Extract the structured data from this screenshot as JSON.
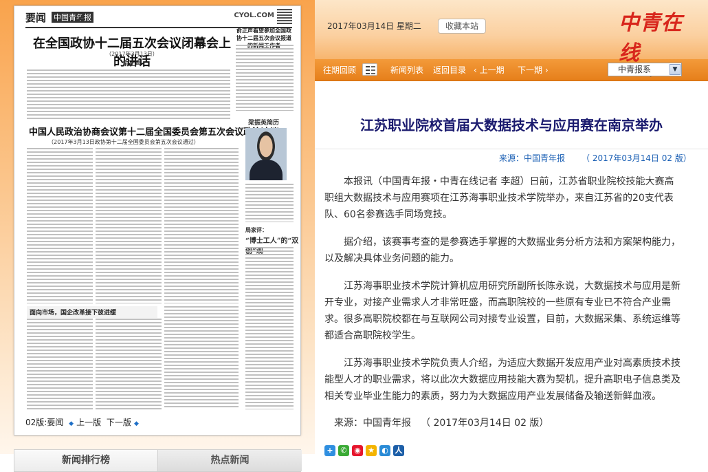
{
  "header": {
    "date": "2017年03月14日  星期二",
    "favorite_label": "收藏本站",
    "logo_text": "中青在线",
    "logo_url": "www.cyol.com"
  },
  "nav": {
    "past_review": "往期回顾",
    "news_list": "新闻列表",
    "back_to_index": "返回目录",
    "prev_edition": "上一期",
    "next_edition": "下一期",
    "paper_select": "中青报系"
  },
  "paper": {
    "section": "要闻",
    "paper_name": "中国青年报",
    "page_number": "2",
    "site": "CYOL.COM",
    "headline1": "在全国政协十二届五次会议闭幕会上的讲话",
    "headline1_date": "（2017年3月13日）",
    "headline1_author": "俞正声",
    "side_title": "俞正声看望参加全国政协十二届五次会议报道的新闻工作者",
    "headline2": "中国人民政治协商会议第十二届全国委员会第五次会议政治决议",
    "headline2_sub": "（2017年3月13日政协第十二届全国委员会第五次会议通过）",
    "bio_title": "梁振英简历",
    "column_label": "局家评：",
    "column_title": "“博士工人”的“双创”观",
    "market_title": "面向市场，国企改革接下彼进缓",
    "footer": {
      "current": "02版:要闻",
      "prev": "上一版",
      "next": "下一版"
    }
  },
  "tabs": {
    "ranking": "新闻排行榜",
    "hot": "热点新闻"
  },
  "article": {
    "title": "江苏职业院校首届大数据技术与应用赛在南京举办",
    "source_label": "来源：中国青年报",
    "meta_date": "（ 2017年03月14日 02 版）",
    "paragraphs": [
      "本报讯（中国青年报・中青在线记者 李超）日前，江苏省职业院校技能大赛高职组大数据技术与应用赛项在江苏海事职业技术学院举办，来自江苏省的20支代表队、60名参赛选手同场竞技。",
      "据介绍，该赛事考查的是参赛选手掌握的大数据业务分析方法和方案架构能力，以及解决具体业务问题的能力。",
      "江苏海事职业技术学院计算机应用研究所副所长陈永说，大数据技术与应用是新开专业，对接产业需求人才非常旺盛，而高职院校的一些原有专业已不符合产业需求。很多高职院校都在与互联网公司对接专业设置，目前，大数据采集、系统运维等都适合高职院校学生。",
      "江苏海事职业技术学院负责人介绍，为适应大数据开发应用产业对高素质技术技能型人才的职业需求，将以此次大数据应用技能大赛为契机，提升高职电子信息类及相关专业毕业生能力的素质，努力为大数据应用产业发展储备及输送新鲜血液。"
    ],
    "footer_source": "来源：中国青年报",
    "footer_date": "（ 2017年03月14日 02 版）"
  },
  "share_icons": [
    {
      "name": "share-plus-icon",
      "color": "#2f8fe0",
      "glyph": "+"
    },
    {
      "name": "wechat-icon",
      "color": "#3aaa35",
      "glyph": "✆"
    },
    {
      "name": "weibo-icon",
      "color": "#e6162d",
      "glyph": "◉"
    },
    {
      "name": "qzone-icon",
      "color": "#f4b400",
      "glyph": "★"
    },
    {
      "name": "tencent-weibo-icon",
      "color": "#2a8bd6",
      "glyph": "◐"
    },
    {
      "name": "renren-icon",
      "color": "#1d5fa8",
      "glyph": "人"
    }
  ]
}
